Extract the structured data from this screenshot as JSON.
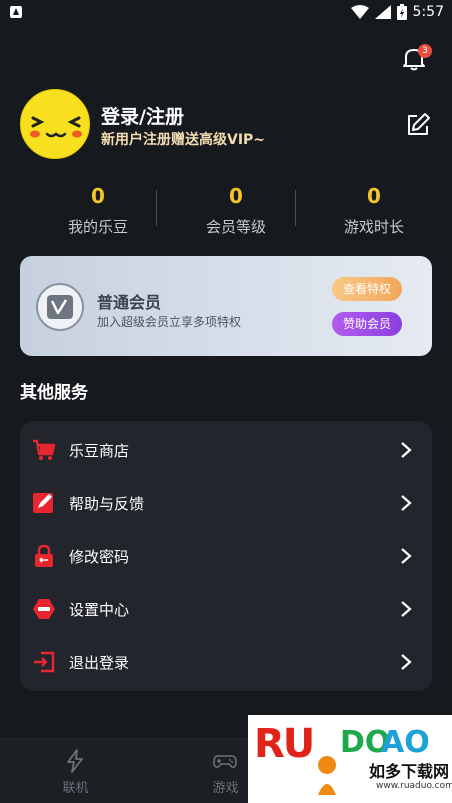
{
  "statusbar": {
    "time": "5:57"
  },
  "notifications": {
    "count": "3"
  },
  "user": {
    "title": "登录/注册",
    "subtitle": "新用户注册赠送高级VIP~"
  },
  "stats": [
    {
      "value": "0",
      "label": "我的乐豆"
    },
    {
      "value": "0",
      "label": "会员等级"
    },
    {
      "value": "0",
      "label": "游戏时长"
    }
  ],
  "vip_card": {
    "title": "普通会员",
    "subtitle": "加入超级会员立享多项特权",
    "btn_privileges": "查看特权",
    "btn_sponsor": "赞助会员"
  },
  "services": {
    "title": "其他服务",
    "items": [
      {
        "label": "乐豆商店",
        "icon": "cart-icon"
      },
      {
        "label": "帮助与反馈",
        "icon": "feedback-icon"
      },
      {
        "label": "修改密码",
        "icon": "lock-icon"
      },
      {
        "label": "设置中心",
        "icon": "settings-icon"
      },
      {
        "label": "退出登录",
        "icon": "logout-icon"
      }
    ]
  },
  "tabbar": {
    "tabs": [
      {
        "label": "联机",
        "icon": "lightning-icon"
      },
      {
        "label": "游戏",
        "icon": "gamepad-icon"
      }
    ]
  },
  "watermark": {
    "brand_ru": "RU",
    "brand_do": "DO",
    "brand_ao": "AO",
    "cn": "如多下载网",
    "url": "www.ruaduo.com"
  },
  "colors": {
    "background": "#16191d",
    "stat_value": "#f4c52a",
    "accent_red": "#e8262f"
  }
}
